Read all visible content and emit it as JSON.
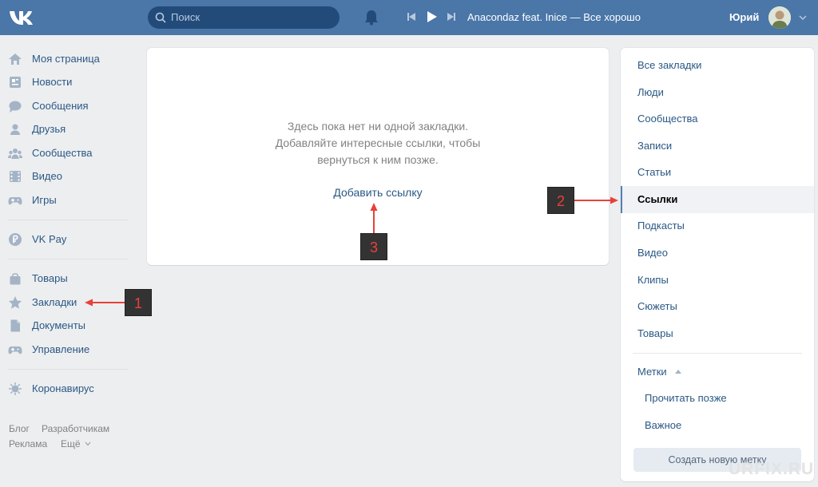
{
  "header": {
    "search_placeholder": "Поиск",
    "track": "Anacondaz feat. Inice — Все хорошо",
    "username": "Юрий"
  },
  "leftnav": {
    "items": [
      {
        "label": "Моя страница",
        "icon": "home-icon"
      },
      {
        "label": "Новости",
        "icon": "news-icon"
      },
      {
        "label": "Сообщения",
        "icon": "messages-icon"
      },
      {
        "label": "Друзья",
        "icon": "friends-icon"
      },
      {
        "label": "Сообщества",
        "icon": "groups-icon"
      },
      {
        "label": "Видео",
        "icon": "video-icon"
      },
      {
        "label": "Игры",
        "icon": "games-icon"
      },
      {
        "label": "VK Pay",
        "icon": "vkpay-icon"
      },
      {
        "label": "Товары",
        "icon": "market-icon"
      },
      {
        "label": "Закладки",
        "icon": "star-icon"
      },
      {
        "label": "Документы",
        "icon": "document-icon"
      },
      {
        "label": "Управление",
        "icon": "gamepad-icon"
      },
      {
        "label": "Коронавирус",
        "icon": "virus-icon"
      }
    ],
    "footer": {
      "blog": "Блог",
      "developers": "Разработчикам",
      "ads": "Реклама",
      "more": "Ещё"
    }
  },
  "main": {
    "empty_lines": [
      "Здесь пока нет ни одной закладки.",
      "Добавляйте интересные ссылки, чтобы",
      "вернуться к ним позже."
    ],
    "add_link": "Добавить ссылку"
  },
  "rightnav": {
    "items": [
      {
        "label": "Все закладки"
      },
      {
        "label": "Люди"
      },
      {
        "label": "Сообщества"
      },
      {
        "label": "Записи"
      },
      {
        "label": "Статьи"
      },
      {
        "label": "Ссылки",
        "active": true
      },
      {
        "label": "Подкасты"
      },
      {
        "label": "Видео"
      },
      {
        "label": "Клипы"
      },
      {
        "label": "Сюжеты"
      },
      {
        "label": "Товары"
      }
    ],
    "tags_header": "Метки",
    "tags": [
      "Прочитать позже",
      "Важное"
    ],
    "new_tag_button": "Создать новую метку"
  },
  "annotations": {
    "badge1": "1",
    "badge2": "2",
    "badge3": "3"
  },
  "watermark": "URFIX.RU",
  "colors": {
    "header": "#4a76a8",
    "link": "#2a5885",
    "annotation": "#e8413b"
  }
}
